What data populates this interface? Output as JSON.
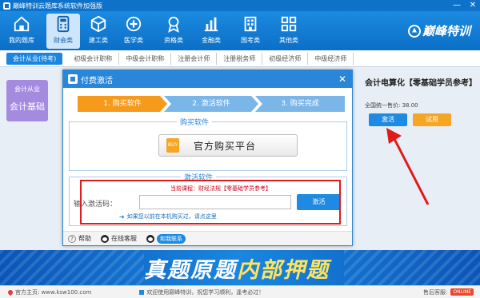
{
  "window": {
    "title": "巅峰特训云题库系统软件加强版",
    "buttons": {
      "minimize": "—",
      "close": "✕"
    }
  },
  "topnav": {
    "items": [
      {
        "label": "我的题库",
        "icon": "home-icon"
      },
      {
        "label": "财会类",
        "icon": "calculator-icon",
        "active": true
      },
      {
        "label": "建工类",
        "icon": "cube-icon"
      },
      {
        "label": "医学类",
        "icon": "medical-cross-icon"
      },
      {
        "label": "资格类",
        "icon": "badge-icon"
      },
      {
        "label": "金融类",
        "icon": "bar-chart-icon"
      },
      {
        "label": "国考类",
        "icon": "building-icon"
      },
      {
        "label": "其他类",
        "icon": "grid-icon"
      }
    ],
    "brand": "巅峰特训"
  },
  "category_tabs": [
    {
      "label": "会计从业(待考)",
      "active": true
    },
    {
      "label": "初级会计职称"
    },
    {
      "label": "中级会计职称"
    },
    {
      "label": "注册会计师"
    },
    {
      "label": "注册税务师"
    },
    {
      "label": "初级经济师"
    },
    {
      "label": "中级经济师"
    }
  ],
  "course_card": {
    "line1": "会计从业",
    "line2": "会计基础"
  },
  "product": {
    "title": "会计电算化【零基础学员参考】",
    "price": "全国统一售价: 38.00",
    "activate_label": "激活",
    "trial_label": "试用"
  },
  "dialog": {
    "title": "付费激活",
    "close": "✕",
    "steps": [
      "1. 购买软件",
      "2. 激活软件",
      "3. 购买完成"
    ],
    "buy_section_title": "购买软件",
    "buy_logo": "BUY",
    "buy_button": "官方购买平台",
    "activate_section_title": "激活软件",
    "current_course": "当前课程：财经法规【零基础学员参考】",
    "code_label": "输入激活码：",
    "code_value": "",
    "activate_button": "激活",
    "purchased_link": "如果您以前在本机购买过，请点这里",
    "footer": {
      "help": "帮助",
      "online_service": "在线客服",
      "contact_badge": "和我联系"
    }
  },
  "banner": {
    "text_a": "真题原题",
    "text_b": "内部押题"
  },
  "statusbar": {
    "home": "官方主页: www.ksw100.com",
    "welcome": "欢迎使用巅峰特训，祝您学习顺利，逢考必过！",
    "service": "售后客服:",
    "online_badge": "ONLINE"
  },
  "colors": {
    "primary": "#1a86df",
    "step_active": "#f59a1b",
    "highlight_red": "#e01b1b",
    "course_card": "#a58be0"
  }
}
